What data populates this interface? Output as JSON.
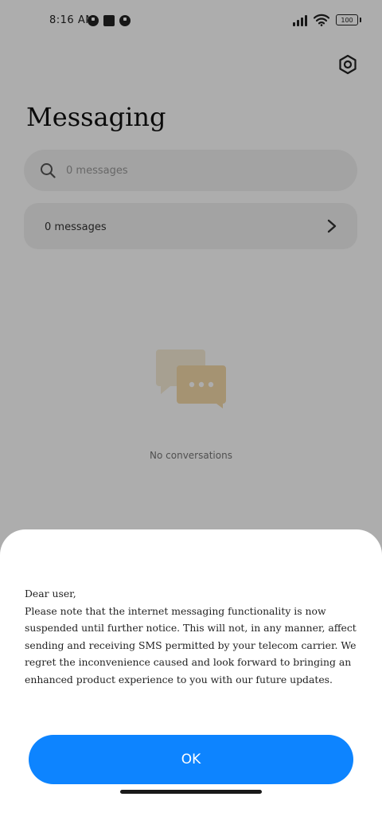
{
  "status_bar": {
    "time": "8:16 AM",
    "battery": "100"
  },
  "header": {
    "title": "Messaging",
    "settings_icon": "gear-icon"
  },
  "search": {
    "placeholder": "0 messages"
  },
  "messages_row": {
    "label": "0 messages"
  },
  "empty_state": {
    "text": "No conversations",
    "icon": "chat-bubbles-icon",
    "colors": {
      "back_bubble": "#f6ecd6",
      "front_bubble": "#f3d9a8",
      "dots": "#ffffff"
    }
  },
  "dialog": {
    "greeting": "Dear user,",
    "body": "Please note that the internet messaging functionality is now suspended until further notice. This will not, in any manner, affect sending and receiving SMS permitted by your telecom carrier. We regret the inconvenience caused and look forward to bringing an enhanced product experience to you with our future updates.",
    "ok_label": "OK"
  },
  "colors": {
    "accent": "#0d84ff",
    "scrim": "rgba(0,0,0,0.32)"
  }
}
